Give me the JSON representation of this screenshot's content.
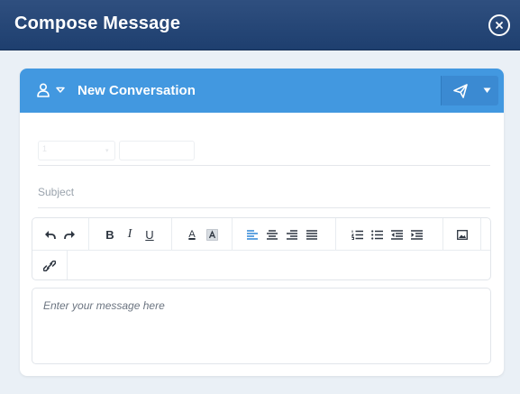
{
  "window": {
    "title": "Compose Message"
  },
  "conversation": {
    "title": "New Conversation"
  },
  "recipients": {
    "field1_value": "1",
    "field2_value": ""
  },
  "subject": {
    "placeholder": "Subject"
  },
  "toolbar": {
    "groups": [
      [
        "undo-icon",
        "redo-icon"
      ],
      [
        "bold",
        "italic",
        "underline"
      ],
      [
        "text-color",
        "highlight-color"
      ],
      [
        "align-left",
        "align-center",
        "align-right",
        "align-justify"
      ],
      [
        "ordered-list",
        "unordered-list",
        "outdent",
        "indent"
      ],
      [
        "image"
      ],
      [
        "link"
      ]
    ],
    "bold_label": "B",
    "italic_label": "I",
    "underline_label": "U",
    "color_label": "A"
  },
  "editor": {
    "placeholder": "Enter your message here"
  },
  "colors": {
    "header": "#1e3f6f",
    "accent": "#4298e0",
    "active_tool": "#2f86d6"
  }
}
